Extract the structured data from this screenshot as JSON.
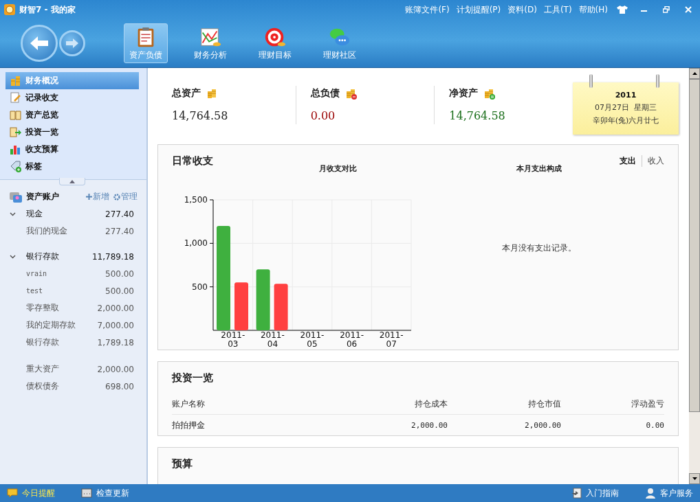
{
  "window": {
    "title": "财智7 - 我的家"
  },
  "menu": [
    {
      "label": "账簿文件(F)"
    },
    {
      "label": "计划提醒(P)"
    },
    {
      "label": "资料(D)"
    },
    {
      "label": "工具(T)"
    },
    {
      "label": "帮助(H)"
    }
  ],
  "toolbar": [
    {
      "label": "资产负债",
      "kind": "ledger",
      "selected": true
    },
    {
      "label": "财务分析",
      "kind": "analysis",
      "selected": false
    },
    {
      "label": "理财目标",
      "kind": "target",
      "selected": false
    },
    {
      "label": "理财社区",
      "kind": "community",
      "selected": false
    }
  ],
  "sidebar": {
    "items": [
      {
        "label": "财务概况",
        "kind": "coins",
        "selected": true
      },
      {
        "label": "记录收支",
        "kind": "note",
        "selected": false
      },
      {
        "label": "资产总览",
        "kind": "book",
        "selected": false
      },
      {
        "label": "投资一览",
        "kind": "invest",
        "selected": false
      },
      {
        "label": "收支预算",
        "kind": "budget",
        "selected": false
      },
      {
        "label": "标签",
        "kind": "tag",
        "selected": false
      }
    ],
    "accounts_title": "资产账户",
    "add": "新增",
    "manage": "管理",
    "accounts": [
      {
        "kind": "group",
        "name": "现金",
        "amount": "277.40",
        "expanded": true,
        "children": [
          {
            "name": "我们的现金",
            "amount": "277.40"
          }
        ]
      },
      {
        "kind": "group",
        "name": "银行存款",
        "amount": "11,789.18",
        "expanded": true,
        "children": [
          {
            "name": "vrain",
            "amount": "500.00"
          },
          {
            "name": "test",
            "amount": "500.00"
          },
          {
            "name": "零存整取",
            "amount": "2,000.00"
          },
          {
            "name": "我的定期存款",
            "amount": "7,000.00"
          },
          {
            "name": "银行存款",
            "amount": "1,789.18"
          }
        ]
      },
      {
        "kind": "account",
        "name": "重大资产",
        "amount": "2,000.00"
      },
      {
        "kind": "account",
        "name": "债权债务",
        "amount": "698.00"
      }
    ]
  },
  "summary": [
    {
      "label": "总资产",
      "value": "14,764.58",
      "color": "#222222",
      "kind": "plain"
    },
    {
      "label": "总负债",
      "value": "0.00",
      "color": "#990000",
      "kind": "minus"
    },
    {
      "label": "净资产",
      "value": "14,764.58",
      "color": "#1a6e1a",
      "kind": "equal"
    }
  ],
  "calendar": {
    "year": "2011",
    "date": "07月27日  星期三",
    "lunar": "辛卯年(兔)六月廿七"
  },
  "daily": {
    "title": "日常收支",
    "tabs": [
      {
        "label": "支出",
        "selected": true
      },
      {
        "label": "收入",
        "selected": false
      }
    ],
    "chart_data": {
      "type": "bar",
      "title": "月收支对比",
      "categories": [
        "2011-03",
        "2011-04",
        "2011-05",
        "2011-06",
        "2011-07"
      ],
      "series": [
        {
          "color": "#3fb03f",
          "values": [
            1200,
            700,
            null,
            null,
            null
          ]
        },
        {
          "color": "#ff4040",
          "values": [
            550,
            535,
            null,
            null,
            null
          ]
        }
      ],
      "ylim": [
        0,
        1500
      ],
      "yticks": [
        {
          "value": 500,
          "label": "500"
        },
        {
          "value": 1000,
          "label": "1,000"
        },
        {
          "value": 1500,
          "label": "1,500"
        }
      ]
    },
    "breakdown_title": "本月支出构成",
    "empty_message": "本月没有支出记录。"
  },
  "investments": {
    "title": "投资一览",
    "columns": [
      "账户名称",
      "持仓成本",
      "持仓市值",
      "浮动盈亏"
    ],
    "rows": [
      [
        "拍拍押金",
        "2,000.00",
        "2,000.00",
        "0.00"
      ]
    ]
  },
  "budget": {
    "title": "预算"
  },
  "status_bar": {
    "left": [
      {
        "label": "今日提醒",
        "kind": "reminder"
      },
      {
        "label": "检查更新",
        "kind": "update"
      }
    ],
    "right": [
      {
        "label": "入门指南",
        "kind": "guide"
      },
      {
        "label": "客户服务",
        "kind": "service"
      }
    ]
  }
}
